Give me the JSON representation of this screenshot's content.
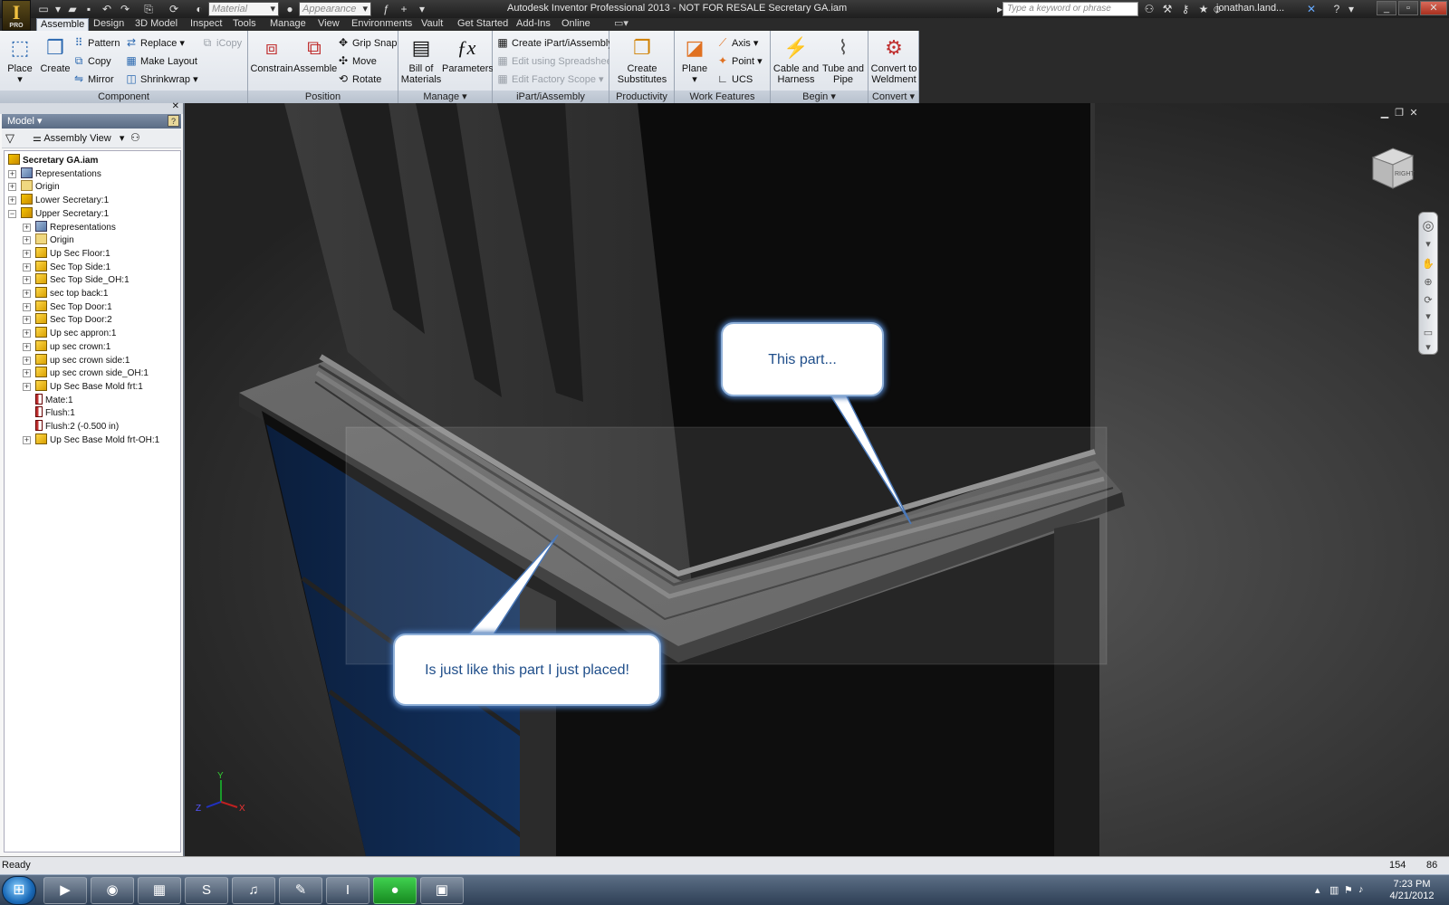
{
  "window": {
    "title": "Autodesk Inventor Professional 2013 - NOT FOR RESALE   Secretary GA.iam",
    "search_placeholder": "Type a keyword or phrase",
    "user": "jonathan.land...",
    "logo_text": "PRO",
    "material_placeholder": "Material",
    "appearance_placeholder": "Appearance"
  },
  "tabs": [
    "Assemble",
    "Design",
    "3D Model",
    "Inspect",
    "Tools",
    "Manage",
    "View",
    "Environments",
    "Vault",
    "Get Started",
    "Add-Ins",
    "Online"
  ],
  "ribbon": {
    "component": {
      "label": "Component",
      "place": "Place",
      "create": "Create",
      "pattern": "Pattern",
      "copy": "Copy",
      "mirror": "Mirror",
      "replace": "Replace",
      "make_layout": "Make Layout",
      "shrinkwrap": "Shrinkwrap",
      "icopy": "iCopy"
    },
    "position": {
      "label": "Position",
      "constrain": "Constrain",
      "assemble": "Assemble",
      "grip_snap": "Grip Snap",
      "move": "Move",
      "rotate": "Rotate"
    },
    "manage": {
      "label": "Manage",
      "bom_line1": "Bill of",
      "bom_line2": "Materials",
      "parameters": "Parameters"
    },
    "ipart": {
      "label": "iPart/iAssembly",
      "create": "Create iPart/iAssembly",
      "edit_spreadsheet": "Edit using Spreadsheet",
      "edit_factory": "Edit Factory Scope"
    },
    "productivity": {
      "label": "Productivity",
      "line1": "Create",
      "line2": "Substitutes"
    },
    "work_features": {
      "label": "Work Features",
      "plane": "Plane",
      "axis": "Axis",
      "point": "Point",
      "ucs": "UCS"
    },
    "begin": {
      "label": "Begin",
      "cable_line1": "Cable and",
      "cable_line2": "Harness",
      "tube_line1": "Tube and",
      "tube_line2": "Pipe"
    },
    "convert": {
      "label": "Convert",
      "line1": "Convert to",
      "line2": "Weldment"
    }
  },
  "browser": {
    "header": "Model",
    "view_mode": "Assembly View",
    "nodes": [
      {
        "label": "Secretary GA.iam",
        "icon": "assembly-icon",
        "level": 0
      },
      {
        "label": "Representations",
        "icon": "representations-icon",
        "level": 1
      },
      {
        "label": "Origin",
        "icon": "folder-icon",
        "level": 1
      },
      {
        "label": "Lower Secretary:1",
        "icon": "assembly-icon",
        "level": 1
      },
      {
        "label": "Upper Secretary:1",
        "icon": "assembly-icon",
        "level": 1
      },
      {
        "label": "Representations",
        "icon": "representations-icon",
        "level": 2
      },
      {
        "label": "Origin",
        "icon": "folder-icon",
        "level": 2
      },
      {
        "label": "Up Sec Floor:1",
        "icon": "part-icon",
        "level": 2
      },
      {
        "label": "Sec Top Side:1",
        "icon": "part-icon",
        "level": 2
      },
      {
        "label": "Sec Top Side_OH:1",
        "icon": "part-icon",
        "level": 2
      },
      {
        "label": "sec top back:1",
        "icon": "part-icon",
        "level": 2
      },
      {
        "label": "Sec Top Door:1",
        "icon": "part-icon",
        "level": 2
      },
      {
        "label": "Sec Top Door:2",
        "icon": "part-icon",
        "level": 2
      },
      {
        "label": "Up sec appron:1",
        "icon": "part-icon",
        "level": 2
      },
      {
        "label": "up sec crown:1",
        "icon": "part-icon",
        "level": 2
      },
      {
        "label": "up sec crown side:1",
        "icon": "part-icon",
        "level": 2
      },
      {
        "label": "up sec crown side_OH:1",
        "icon": "part-icon",
        "level": 2
      },
      {
        "label": "Up Sec Base Mold frt:1",
        "icon": "part-icon",
        "level": 2
      },
      {
        "label": "Mate:1",
        "icon": "mate-icon",
        "level": 3
      },
      {
        "label": "Flush:1",
        "icon": "mate-icon",
        "level": 3
      },
      {
        "label": "Flush:2 (-0.500 in)",
        "icon": "mate-icon",
        "level": 3
      },
      {
        "label": "Up Sec Base Mold frt-OH:1",
        "icon": "part-icon",
        "level": 2
      }
    ]
  },
  "viewport": {
    "callout_top": "This part...",
    "callout_bottom": "Is just like this part I just placed!",
    "viewcube_label": "RIGHT",
    "axis_x": "X",
    "axis_y": "Y",
    "axis_z": "Z"
  },
  "status": {
    "text": "Ready",
    "count1": "154",
    "count2": "86"
  },
  "taskbar": {
    "time": "7:23 PM",
    "date": "4/21/2012"
  }
}
